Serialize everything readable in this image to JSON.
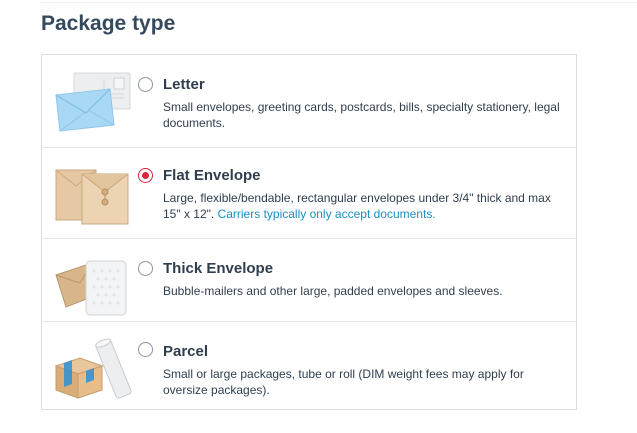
{
  "section": {
    "title": "Package type"
  },
  "options": [
    {
      "id": "letter",
      "title": "Letter",
      "description": "Small envelopes, greeting cards, postcards, bills, specialty stationery, legal documents.",
      "selected": false,
      "icon": "letter-envelope-illustration"
    },
    {
      "id": "flat-envelope",
      "title": "Flat Envelope",
      "description": "Large, flexible/bendable, rectangular envelopes under 3/4\" thick and max 15\" x 12\".",
      "note": "Carriers typically only accept documents.",
      "selected": true,
      "icon": "flat-envelope-illustration"
    },
    {
      "id": "thick-envelope",
      "title": "Thick Envelope",
      "description": "Bubble-mailers and other large, padded envelopes and sleeves.",
      "selected": false,
      "icon": "padded-mailer-illustration"
    },
    {
      "id": "parcel",
      "title": "Parcel",
      "description": "Small or large packages, tube or roll (DIM weight fees may apply for oversize packages).",
      "selected": false,
      "icon": "box-and-tube-illustration"
    }
  ],
  "colors": {
    "accent": "#d9263a",
    "link": "#1a8fc4",
    "heading": "#34495e",
    "border": "#d9dde1"
  }
}
